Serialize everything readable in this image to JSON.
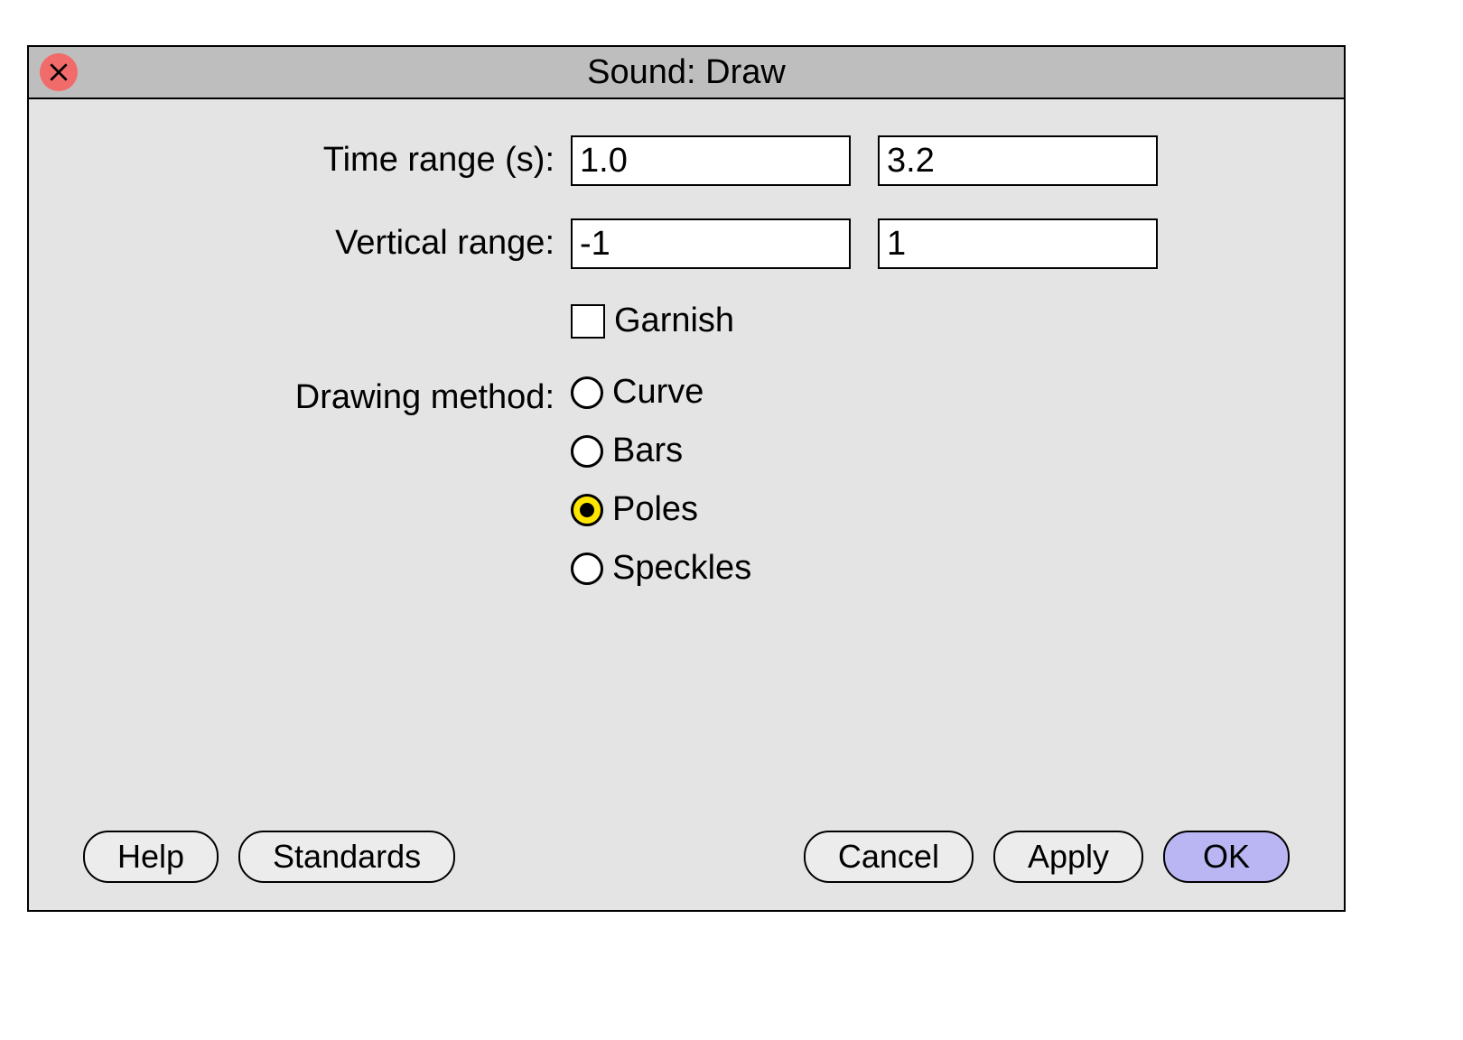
{
  "title": "Sound: Draw",
  "fields": {
    "timeRange": {
      "label": "Time range (s):",
      "from": "1.0",
      "to": "3.2"
    },
    "verticalRange": {
      "label": "Vertical range:",
      "from": "-1",
      "to": "1"
    },
    "garnish": {
      "label": "Garnish",
      "checked": false
    },
    "drawingMethod": {
      "label": "Drawing method:",
      "selected": "Poles",
      "options": [
        "Curve",
        "Bars",
        "Poles",
        "Speckles"
      ]
    }
  },
  "buttons": {
    "help": "Help",
    "standards": "Standards",
    "cancel": "Cancel",
    "apply": "Apply",
    "ok": "OK"
  }
}
